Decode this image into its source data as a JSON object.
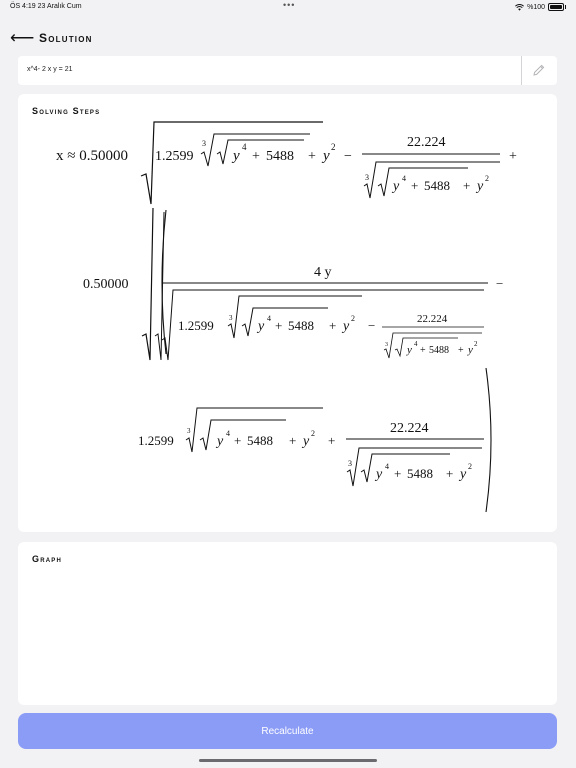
{
  "status_bar": {
    "time": "ÖS 4:19  23 Aralık Cum",
    "dots": "•••",
    "battery_text": "%100"
  },
  "nav": {
    "back_icon": "arrow-left-icon",
    "title": "Solution"
  },
  "equation_input": {
    "value": "x^4- 2 x y = 21",
    "edit_icon": "pencil-icon"
  },
  "solving_steps": {
    "title": "Solving Steps",
    "formula": {
      "lhs": "x ≈ 0.50000",
      "coef": "0.50000",
      "cbrt_coef": "1.2599",
      "cbrt_index": "3",
      "y_base": "y",
      "y_power4": "4",
      "plus": "+",
      "minus": "−",
      "const_inner": "5488",
      "y_power2": "2",
      "frac_num": "22.224",
      "four_y": "4 y"
    }
  },
  "graph": {
    "title": "Graph"
  },
  "recalculate_button": {
    "label": "Recalculate"
  }
}
